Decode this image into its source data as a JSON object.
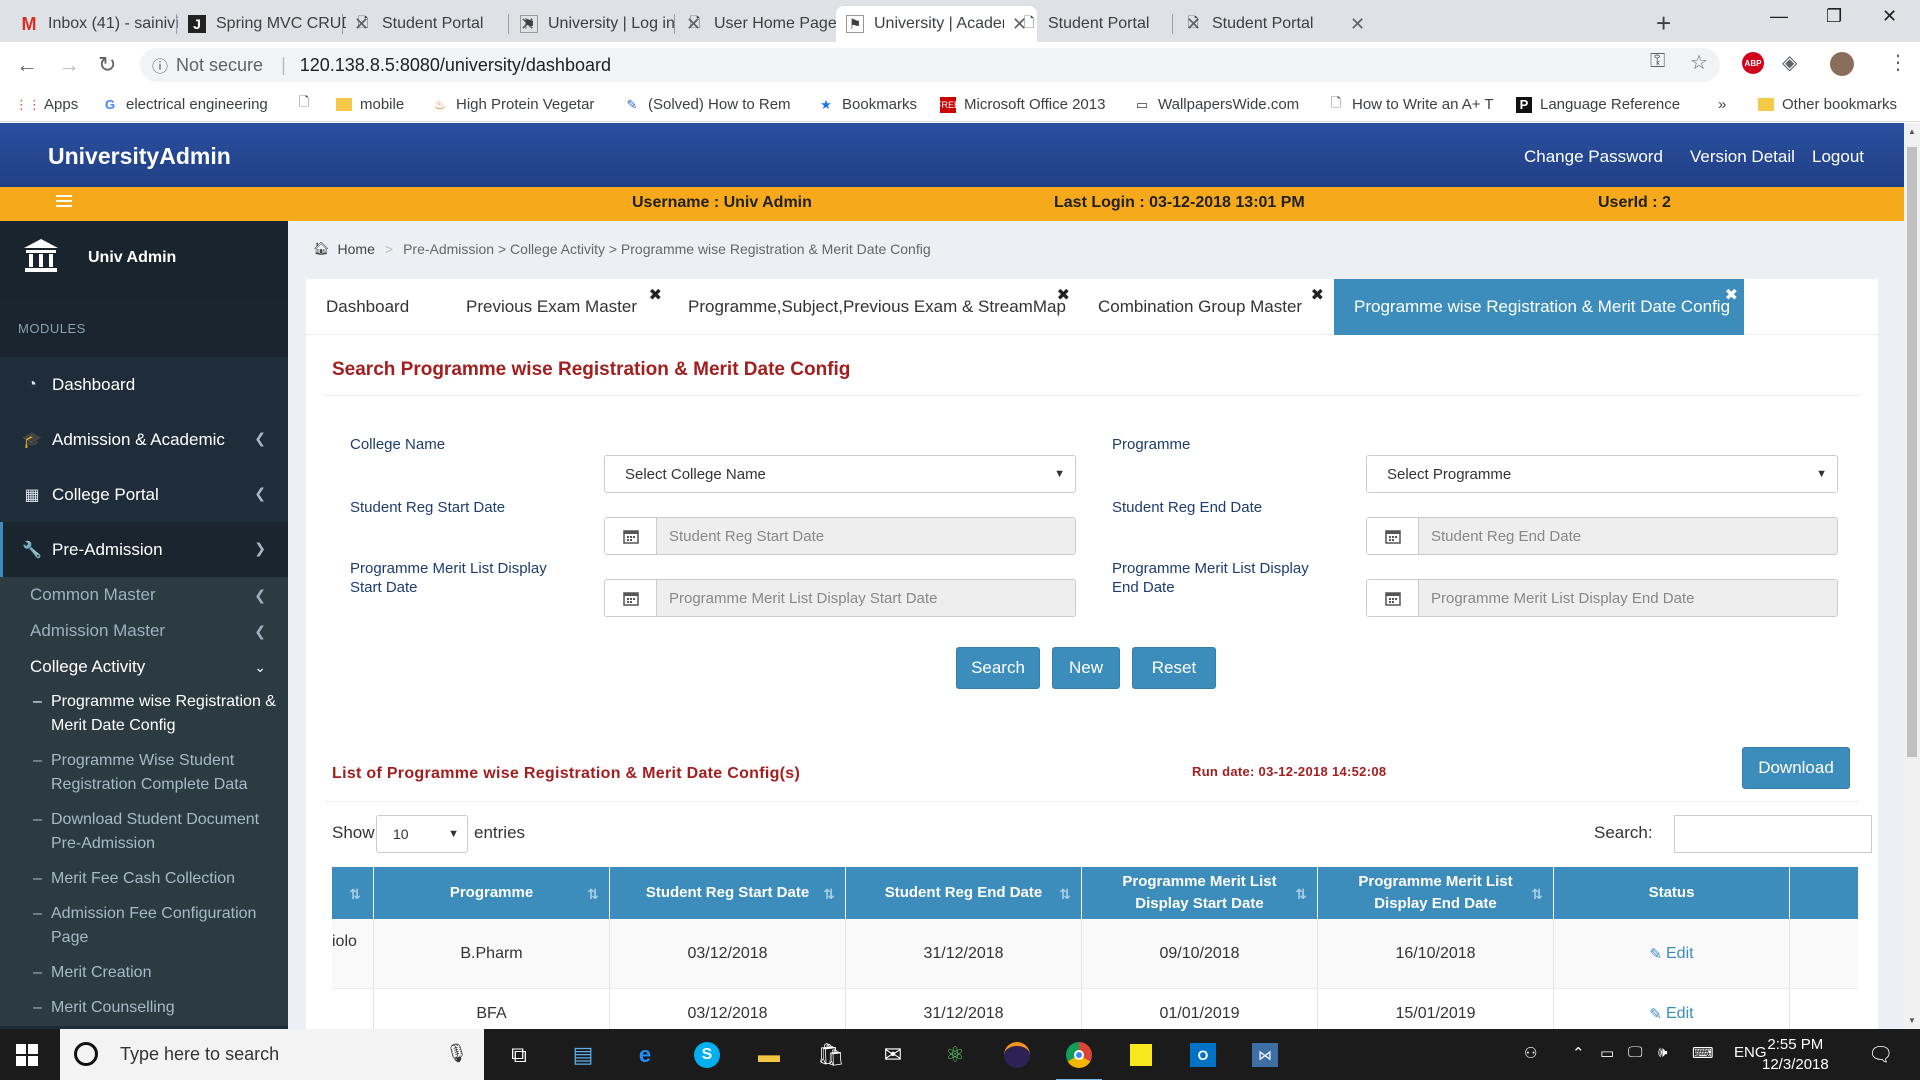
{
  "browser": {
    "tabs": [
      {
        "title": "Inbox (41) - sainivi",
        "icon": "gmail-icon"
      },
      {
        "title": "Spring MVC CRUD",
        "icon": "j-icon"
      },
      {
        "title": "Student Portal",
        "icon": "page-icon"
      },
      {
        "title": "University | Log in",
        "icon": "university-icon"
      },
      {
        "title": "User Home Page",
        "icon": "page-icon"
      },
      {
        "title": "University | Acader",
        "icon": "university-icon"
      },
      {
        "title": "Student Portal",
        "icon": "page-icon"
      },
      {
        "title": "Student Portal",
        "icon": "page-icon"
      }
    ],
    "security_label": "Not secure",
    "url": "120.138.8.5:8080/university/dashboard",
    "bookmarks": [
      "Apps",
      "electrical engineering",
      "",
      "mobile",
      "High Protein Vegetar",
      "(Solved) How to Rem",
      "Bookmarks",
      "Microsoft Office 2013",
      "WallpapersWide.com",
      "How to Write an A+ T",
      "Language Reference",
      "»",
      "Other bookmarks"
    ]
  },
  "header": {
    "brand": "UniversityAdmin",
    "links": [
      "Change Password",
      "Version Detail",
      "Logout"
    ]
  },
  "infobar": {
    "username": "Username : Univ Admin",
    "last_login": "Last Login : 03-12-2018 13:01 PM",
    "userid": "UserId : 2"
  },
  "sidebar": {
    "user": "Univ Admin",
    "section": "MODULES",
    "items": [
      {
        "label": "Dashboard",
        "icon": "dashboard-icon"
      },
      {
        "label": "Admission & Academic",
        "icon": "graduation-cap-icon"
      },
      {
        "label": "College Portal",
        "icon": "building-icon"
      },
      {
        "label": "Pre-Admission",
        "icon": "wrench-icon"
      }
    ],
    "sub_items": [
      "Common Master",
      "Admission Master",
      "College Activity"
    ],
    "activity_items": [
      "Programme wise Registration & Merit Date Config",
      "Programme Wise Student Registration Complete Data",
      "Download Student Document Pre-Admission",
      "Merit Fee Cash Collection",
      "Admission Fee Configuration Page",
      "Merit Creation",
      "Merit Counselling"
    ]
  },
  "breadcrumb": {
    "home": "Home",
    "path": "Pre-Admission > College Activity > Programme wise Registration & Merit Date Config"
  },
  "content_tabs": [
    "Dashboard",
    "Previous Exam Master",
    "Programme,Subject,Previous Exam & StreamMap",
    "Combination Group Master",
    "Programme wise Registration & Merit Date Config"
  ],
  "search_form": {
    "title": "Search Programme wise Registration & Merit Date Config",
    "college_label": "College Name",
    "college_value": "Select College Name",
    "programme_label": "Programme",
    "programme_value": "Select Programme",
    "reg_start_label": "Student Reg Start Date",
    "reg_start_placeholder": "Student Reg Start Date",
    "reg_end_label": "Student Reg End Date",
    "reg_end_placeholder": "Student Reg End Date",
    "merit_start_label": "Programme Merit List Display Start Date",
    "merit_start_placeholder": "Programme Merit List Display Start Date",
    "merit_end_label": "Programme Merit List Display End Date",
    "merit_end_placeholder": "Programme Merit List Display End Date",
    "buttons": [
      "Search",
      "New",
      "Reset"
    ]
  },
  "list": {
    "title": "List of Programme wise Registration & Merit Date Config(s)",
    "run_date": "Run date: 03-12-2018 14:52:08",
    "download_label": "Download",
    "show_label": "Show",
    "entries_value": "10",
    "entries_label": "entries",
    "search_label": "Search:",
    "columns": [
      "",
      "Programme",
      "Student Reg Start Date",
      "Student Reg End Date",
      "Programme Merit List Display Start Date",
      "Programme Merit List Display End Date",
      "Status"
    ],
    "rows": [
      {
        "first": "iolo",
        "programme": "B.Pharm",
        "reg_start": "03/12/2018",
        "reg_end": "31/12/2018",
        "merit_start": "09/10/2018",
        "merit_end": "16/10/2018",
        "status": "Edit"
      },
      {
        "first": "",
        "programme": "BFA",
        "reg_start": "03/12/2018",
        "reg_end": "31/12/2018",
        "merit_start": "01/01/2019",
        "merit_end": "15/01/2019",
        "status": "Edit"
      }
    ]
  },
  "taskbar": {
    "search_placeholder": "Type here to search",
    "language": "ENG",
    "time": "2:55 PM",
    "date": "12/3/2018"
  },
  "colors": {
    "header_blue": "#2b50a0",
    "infobar_orange": "#f6a91a",
    "sidebar_dark": "#1f2d3a",
    "primary_blue": "#3c8dbc",
    "title_red": "#a31f1f"
  }
}
